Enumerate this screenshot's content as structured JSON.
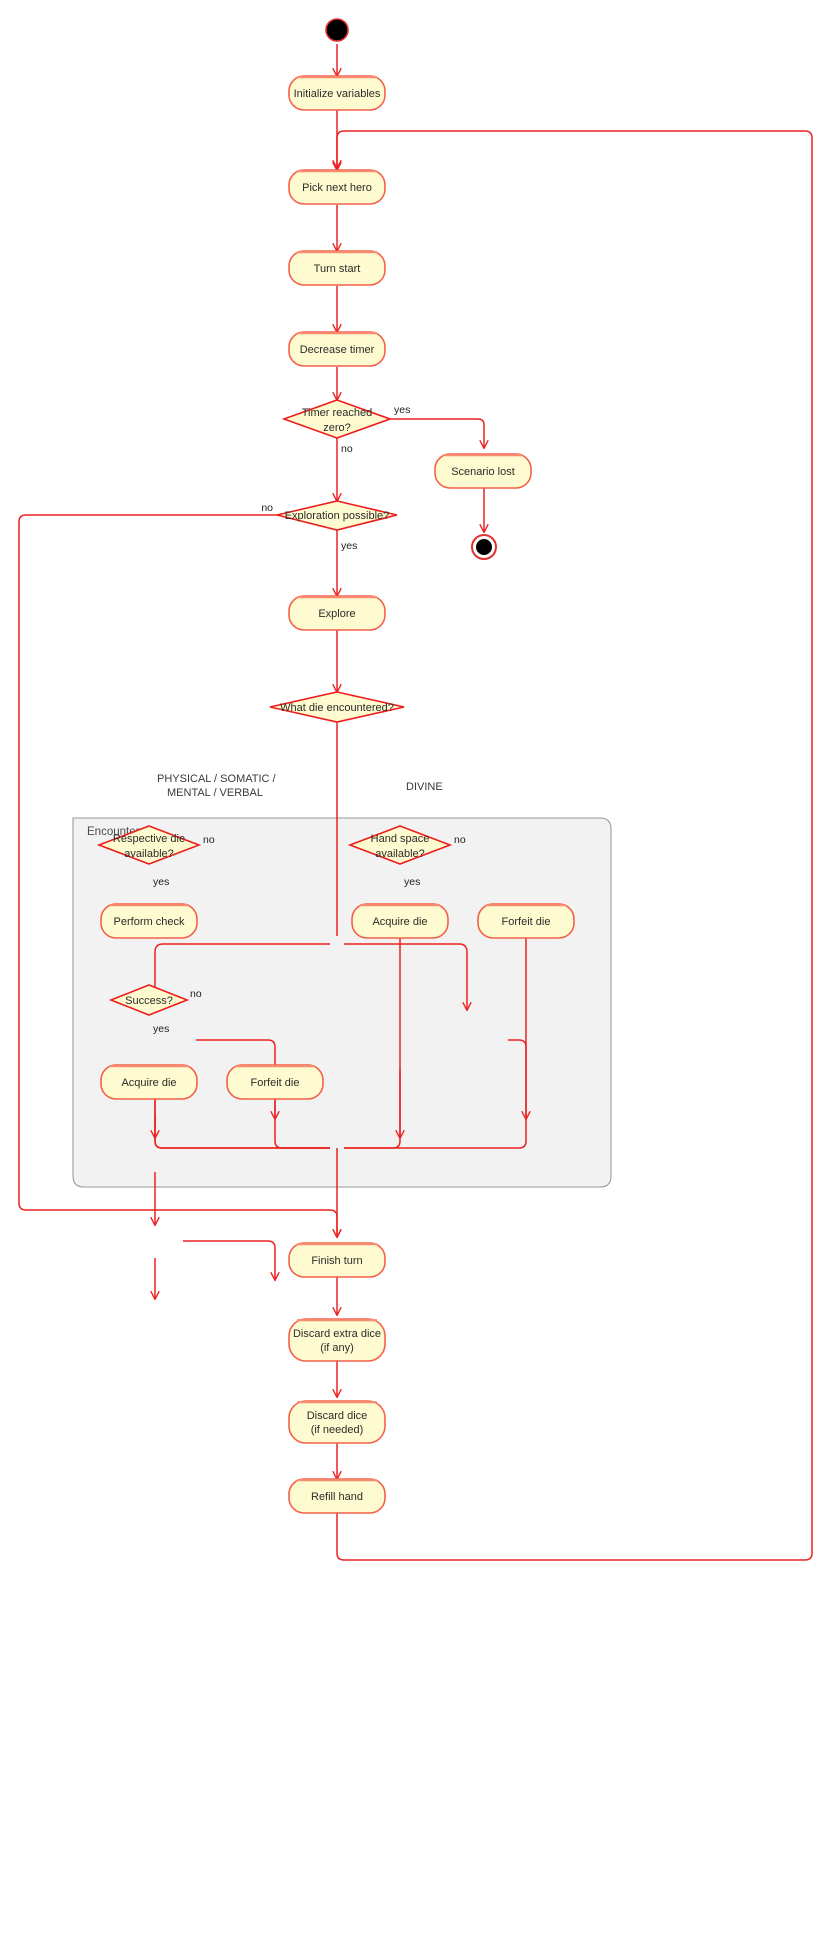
{
  "diagram": {
    "type": "uml-activity-diagram",
    "colors": {
      "node_fill": "#fdfbcf",
      "node_stroke": "#f4604a",
      "decision_stroke": "#ee1d1d",
      "flow": "#ec2222",
      "frame_fill": "#f2f2f2",
      "frame_stroke": "#9a9a9a",
      "text": "#2b2b2b"
    },
    "start_node": "initial-node",
    "end_node": "final-node",
    "group": {
      "label": "Encounter"
    },
    "actions": {
      "initialize_variables": "Initialize variables",
      "pick_next_hero": "Pick next hero",
      "turn_start": "Turn start",
      "decrease_timer": "Decrease timer",
      "scenario_lost": "Scenario lost",
      "explore": "Explore",
      "perform_check": "Perform check",
      "acquire_die_left": "Acquire die",
      "forfeit_die_left": "Forfeit die",
      "acquire_die_right": "Acquire die",
      "forfeit_die_right": "Forfeit die",
      "finish_turn": "Finish turn",
      "discard_extra_dice_line1": "Discard extra dice",
      "discard_extra_dice_line2": "(if any)",
      "discard_dice_line1": "Discard dice",
      "discard_dice_line2": "(if needed)",
      "refill_hand": "Refill hand"
    },
    "decisions": {
      "timer_reached_zero_line1": "Timer reached",
      "timer_reached_zero_line2": "zero?",
      "exploration_possible": "Exploration possible?",
      "what_die_encountered": "What die encountered?",
      "respective_die_line1": "Respective die",
      "respective_die_line2": "available?",
      "hand_space_line1": "Hand space",
      "hand_space_line2": "available?",
      "success": "Success?"
    },
    "edge_labels": {
      "timer_yes": "yes",
      "timer_no": "no",
      "exploration_no": "no",
      "exploration_yes": "yes",
      "respective_no": "no",
      "respective_yes": "yes",
      "success_no": "no",
      "success_yes": "yes",
      "hand_space_no": "no",
      "hand_space_yes": "yes"
    },
    "branch_labels": {
      "physical_line1": "PHYSICAL / SOMATIC /",
      "physical_line2": "MENTAL / VERBAL",
      "divine": "DIVINE"
    }
  }
}
